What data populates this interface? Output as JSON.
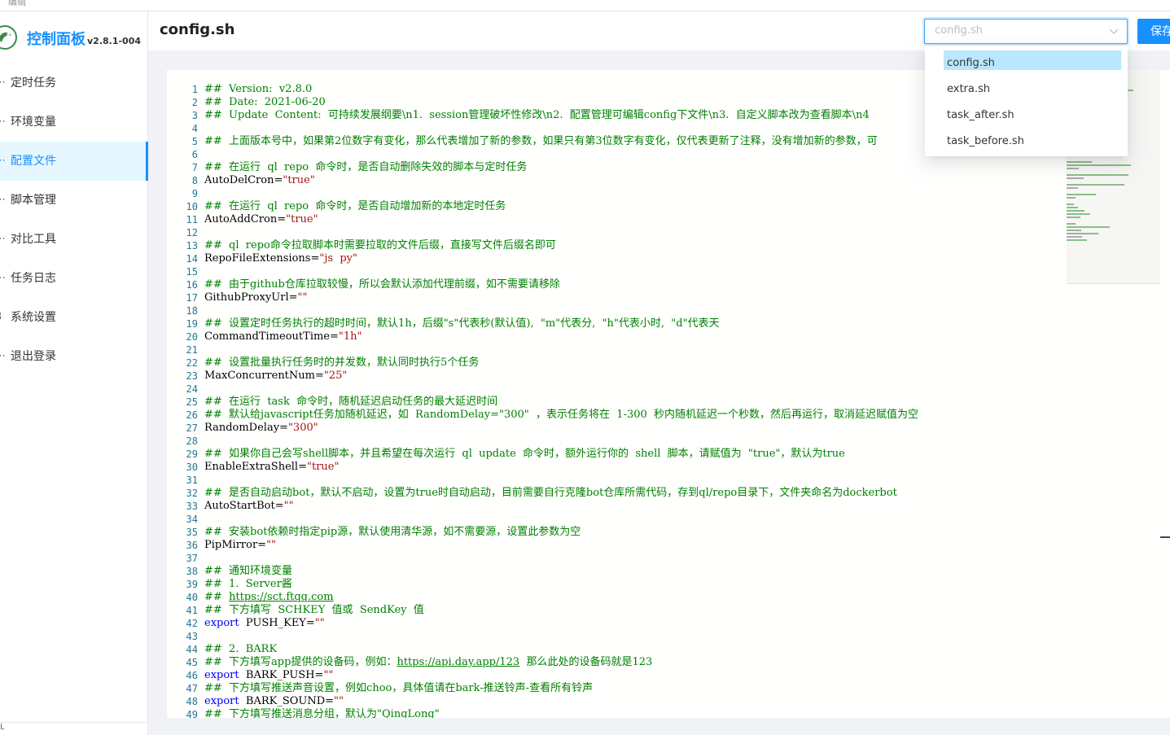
{
  "app": {
    "title": "控制面板",
    "version": "v2.8.1-004",
    "tab_fragment": "编辑",
    "bottom_fragment": "L"
  },
  "colors": {
    "accent": "#1890ff",
    "comment": "#008000",
    "string": "#a31515",
    "keyword": "#0000ff",
    "line_number": "#237893"
  },
  "sidebar": {
    "items": [
      {
        "label": "定时任务",
        "icon": "clock-icon",
        "glyph": "⋯"
      },
      {
        "label": "环境变量",
        "icon": "variable-icon",
        "glyph": "⋯"
      },
      {
        "label": "配置文件",
        "icon": "file-icon",
        "glyph": "⋯",
        "active": true
      },
      {
        "label": "脚本管理",
        "icon": "script-icon",
        "glyph": "⋯"
      },
      {
        "label": "对比工具",
        "icon": "diff-icon",
        "glyph": "⋯"
      },
      {
        "label": "任务日志",
        "icon": "log-icon",
        "glyph": "⋯"
      },
      {
        "label": "系统设置",
        "icon": "settings-icon",
        "glyph": "3"
      },
      {
        "label": "退出登录",
        "icon": "logout-icon",
        "glyph": "⋯"
      }
    ]
  },
  "header": {
    "title": "config.sh",
    "select": {
      "value": "config.sh"
    },
    "save_label": "保存"
  },
  "dropdown": {
    "options": [
      "config.sh",
      "extra.sh",
      "task_after.sh",
      "task_before.sh"
    ],
    "selected": "config.sh"
  },
  "editor": {
    "lines": [
      [
        [
          "c",
          "##  Version:  v2.8.0"
        ]
      ],
      [
        [
          "c",
          "##  Date:  2021-06-20"
        ]
      ],
      [
        [
          "c",
          "##  Update  Content:  可持续发展纲要\\n1.  session管理破坏性修改\\n2.  配置管理可编辑config下文件\\n3.  自定义脚本改为查看脚本\\n4"
        ]
      ],
      [],
      [
        [
          "c",
          "##  上面版本号中，如果第2位数字有变化，那么代表增加了新的参数，如果只有第3位数字有变化，仅代表更新了注释，没有增加新的参数，可"
        ]
      ],
      [],
      [
        [
          "c",
          "##  在运行  ql  repo  命令时，是否自动删除失效的脚本与定时任务"
        ]
      ],
      [
        [
          "v",
          "AutoDelCron="
        ],
        [
          "s",
          "\"true\""
        ]
      ],
      [],
      [
        [
          "c",
          "##  在运行  ql  repo  命令时，是否自动增加新的本地定时任务"
        ]
      ],
      [
        [
          "v",
          "AutoAddCron="
        ],
        [
          "s",
          "\"true\""
        ]
      ],
      [],
      [
        [
          "c",
          "##  ql  repo命令拉取脚本时需要拉取的文件后缀，直接写文件后缀名即可"
        ]
      ],
      [
        [
          "v",
          "RepoFileExtensions="
        ],
        [
          "s",
          "\"js  py\""
        ]
      ],
      [],
      [
        [
          "c",
          "##  由于github仓库拉取较慢，所以会默认添加代理前缀，如不需要请移除"
        ]
      ],
      [
        [
          "v",
          "GithubProxyUrl="
        ],
        [
          "s",
          "\"\""
        ]
      ],
      [],
      [
        [
          "c",
          "##  设置定时任务执行的超时时间，默认1h，后缀\"s\"代表秒(默认值),  \"m\"代表分,  \"h\"代表小时,  \"d\"代表天"
        ]
      ],
      [
        [
          "v",
          "CommandTimeoutTime="
        ],
        [
          "s",
          "\"1h\""
        ]
      ],
      [],
      [
        [
          "c",
          "##  设置批量执行任务时的并发数，默认同时执行5个任务"
        ]
      ],
      [
        [
          "v",
          "MaxConcurrentNum="
        ],
        [
          "s",
          "\"25\""
        ]
      ],
      [],
      [
        [
          "c",
          "##  在运行  task  命令时，随机延迟启动任务的最大延迟时间"
        ]
      ],
      [
        [
          "c",
          "##  默认给javascript任务加随机延迟，如  RandomDelay=\"300\"  ，表示任务将在  1-300  秒内随机延迟一个秒数，然后再运行，取消延迟赋值为空"
        ]
      ],
      [
        [
          "v",
          "RandomDelay="
        ],
        [
          "s",
          "\"300\""
        ]
      ],
      [],
      [
        [
          "c",
          "##  如果你自己会写shell脚本，并且希望在每次运行  ql  update  命令时，额外运行你的  shell  脚本，请赋值为  \"true\"，默认为true"
        ]
      ],
      [
        [
          "v",
          "EnableExtraShell="
        ],
        [
          "s",
          "\"true\""
        ]
      ],
      [],
      [
        [
          "c",
          "##  是否自动启动bot，默认不启动，设置为true时自动启动，目前需要自行克隆bot仓库所需代码，存到ql/repo目录下，文件夹命名为dockerbot"
        ]
      ],
      [
        [
          "v",
          "AutoStartBot="
        ],
        [
          "s",
          "\"\""
        ]
      ],
      [],
      [
        [
          "c",
          "##  安装bot依赖时指定pip源，默认使用清华源，如不需要源，设置此参数为空"
        ]
      ],
      [
        [
          "v",
          "PipMirror="
        ],
        [
          "s",
          "\"\""
        ]
      ],
      [],
      [
        [
          "c",
          "##  通知环境变量"
        ]
      ],
      [
        [
          "c",
          "##  1.  Server酱"
        ]
      ],
      [
        [
          "c",
          "##  "
        ],
        [
          "u",
          "https://sct.ftqq.com"
        ]
      ],
      [
        [
          "c",
          "##  下方填写  SCHKEY  值或  SendKey  值"
        ]
      ],
      [
        [
          "k",
          "export"
        ],
        [
          "v",
          "  PUSH_KEY="
        ],
        [
          "s",
          "\"\""
        ]
      ],
      [],
      [
        [
          "c",
          "##  2.  BARK"
        ]
      ],
      [
        [
          "c",
          "##  下方填写app提供的设备码，例如："
        ],
        [
          "u",
          "https://api.day.app/123"
        ],
        [
          "c",
          "  那么此处的设备码就是123"
        ]
      ],
      [
        [
          "k",
          "export"
        ],
        [
          "v",
          "  BARK_PUSH="
        ],
        [
          "s",
          "\"\""
        ]
      ],
      [
        [
          "c",
          "##  下方填写推送声音设置，例如choo，具体值请在bark-推送铃声-查看所有铃声"
        ]
      ],
      [
        [
          "k",
          "export"
        ],
        [
          "v",
          "  BARK_SOUND="
        ],
        [
          "s",
          "\"\""
        ]
      ],
      [
        [
          "c",
          "##  下方填写推送消息分组，默认为\"QingLong\""
        ]
      ]
    ]
  }
}
